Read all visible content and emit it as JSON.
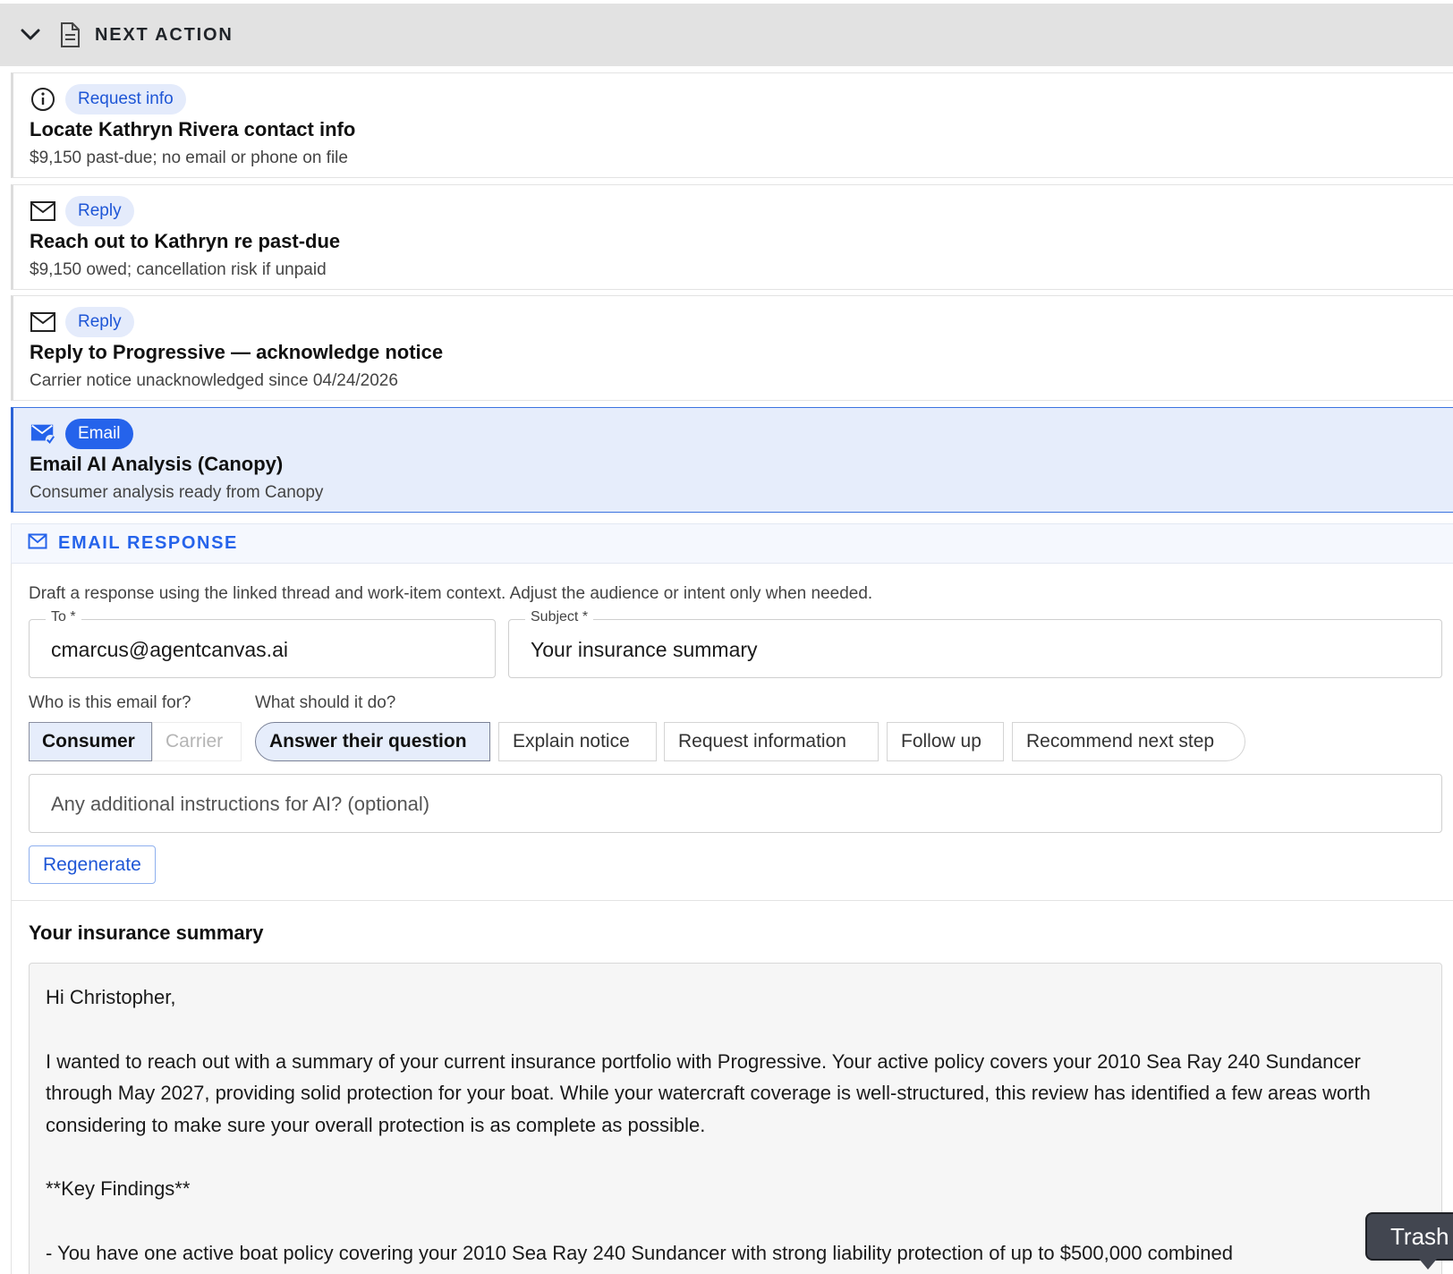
{
  "header": {
    "title": "NEXT ACTION",
    "chevron_icon": "chevron-down-icon",
    "doc_icon": "document-icon"
  },
  "actions": [
    {
      "icon": "info-icon",
      "badge": "Request info",
      "title": "Locate Kathryn Rivera contact info",
      "subtitle": "$9,150 past-due; no email or phone on file"
    },
    {
      "icon": "mail-icon",
      "badge": "Reply",
      "title": "Reach out to Kathryn re past-due",
      "subtitle": "$9,150 owed; cancellation risk if unpaid"
    },
    {
      "icon": "mail-icon",
      "badge": "Reply",
      "title": "Reply to Progressive — acknowledge notice",
      "subtitle": "Carrier notice unacknowledged since 04/24/2026"
    },
    {
      "icon": "mail-check-icon",
      "badge": "Email",
      "title": "Email AI Analysis (Canopy)",
      "subtitle": "Consumer analysis ready from Canopy"
    }
  ],
  "email_response": {
    "section_title": "EMAIL RESPONSE",
    "description": "Draft a response using the linked thread and work-item context. Adjust the audience or intent only when needed.",
    "to_label": "To *",
    "to_value": "cmarcus@agentcanvas.ai",
    "subject_label": "Subject *",
    "subject_value": "Your insurance summary",
    "audience_label": "Who is this email for?",
    "audience_options": [
      "Consumer",
      "Carrier"
    ],
    "audience_selected": "Consumer",
    "intent_label": "What should it do?",
    "intent_options": [
      "Answer their question",
      "Explain notice",
      "Request information",
      "Follow up",
      "Recommend next step"
    ],
    "intent_selected": "Answer their question",
    "instructions_placeholder": "Any additional instructions for AI? (optional)",
    "regenerate_label": "Regenerate",
    "preview_subject": "Your insurance summary",
    "body": {
      "greeting": "Hi Christopher,",
      "para1": "I wanted to reach out with a summary of your current insurance portfolio with Progressive. Your active policy covers your 2010 Sea Ray 240 Sundancer through May 2027, providing solid protection for your boat. While your watercraft coverage is well-structured, this review has identified a few areas worth considering to make sure your overall protection is as complete as possible.",
      "heading": "**Key Findings**",
      "bullet1": "- You have one active boat policy covering your 2010 Sea Ray 240 Sundancer with strong liability protection of up to $500,000 combined"
    }
  },
  "tooltip": {
    "label": "Trash"
  },
  "colors": {
    "accent": "#2563eb",
    "header_bg": "#e2e2e2",
    "active_card_bg": "#e6edfb"
  }
}
